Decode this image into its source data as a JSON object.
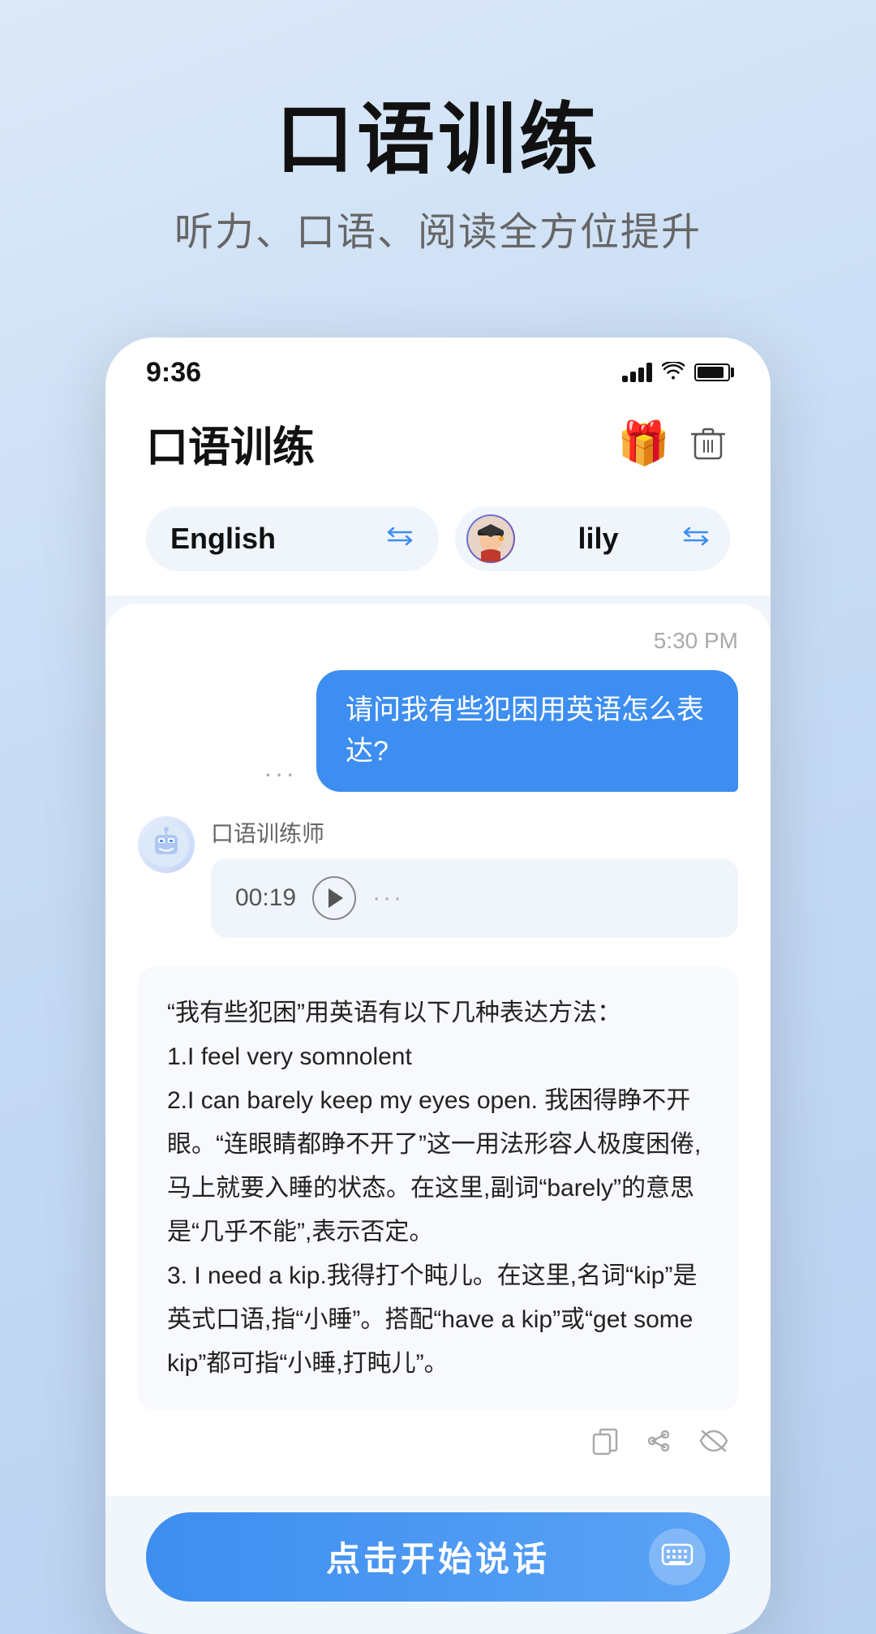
{
  "header": {
    "main_title": "口语训练",
    "sub_title": "听力、口语、阅读全方位提升"
  },
  "status_bar": {
    "time": "9:36"
  },
  "app": {
    "title": "口语训练",
    "gift_icon": "🎁",
    "language_selector": {
      "label": "English",
      "swap_symbol": "⇄"
    },
    "avatar_selector": {
      "name": "lily",
      "swap_symbol": "⇄"
    }
  },
  "chat": {
    "time": "5:30 PM",
    "user_message": "请问我有些犯困用英语怎么表达?",
    "dots": "···",
    "ai_name": "口语训练师",
    "audio_time": "00:19",
    "audio_dots": "···",
    "response_text": "“我有些犯困”用英语有以下几种表达方法：\n1.I feel very somnolent\n2.I can barely keep my eyes open. 我困得睁不开眼。“连眼睛都睁不开了”这一用法形容人极度困倦,马上就要入睡的状态。在这里,副词“barely”的意思是“几乎不能”,表示否定。\n3. I need a kip.我得打个盹儿。在这里,名词“kip”是英式口语,指“小睡”。搭配“have a kip”或“get some kip”都可指“小睡,打盹儿”。"
  },
  "bottom": {
    "start_button_label": "点击开始说话"
  }
}
